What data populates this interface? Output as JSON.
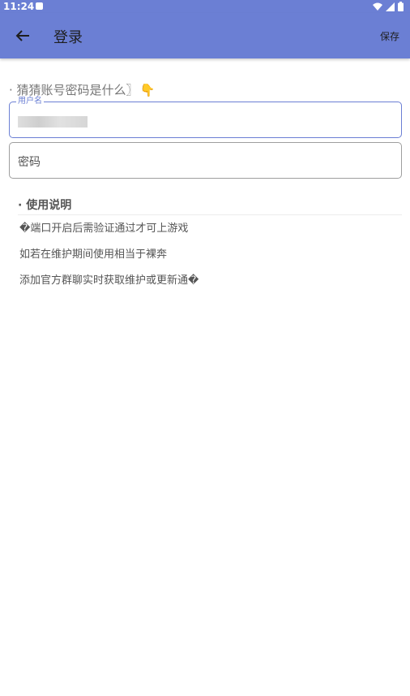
{
  "status_bar": {
    "time": "11:24"
  },
  "app_bar": {
    "title": "登录",
    "save_label": "保存"
  },
  "hint": {
    "text": "· 猜猜账号密码是什么〗"
  },
  "form": {
    "username_label": "用户名",
    "password_placeholder": "密码"
  },
  "instructions": {
    "title": "· 使用说明",
    "lines": [
      "�端口开启后需验证通过才可上游戏",
      "如若在维护期间使用相当于裸奔",
      "添加官方群聊实时获取维护或更新通�"
    ]
  },
  "colors": {
    "accent": "#6b7fd4"
  }
}
